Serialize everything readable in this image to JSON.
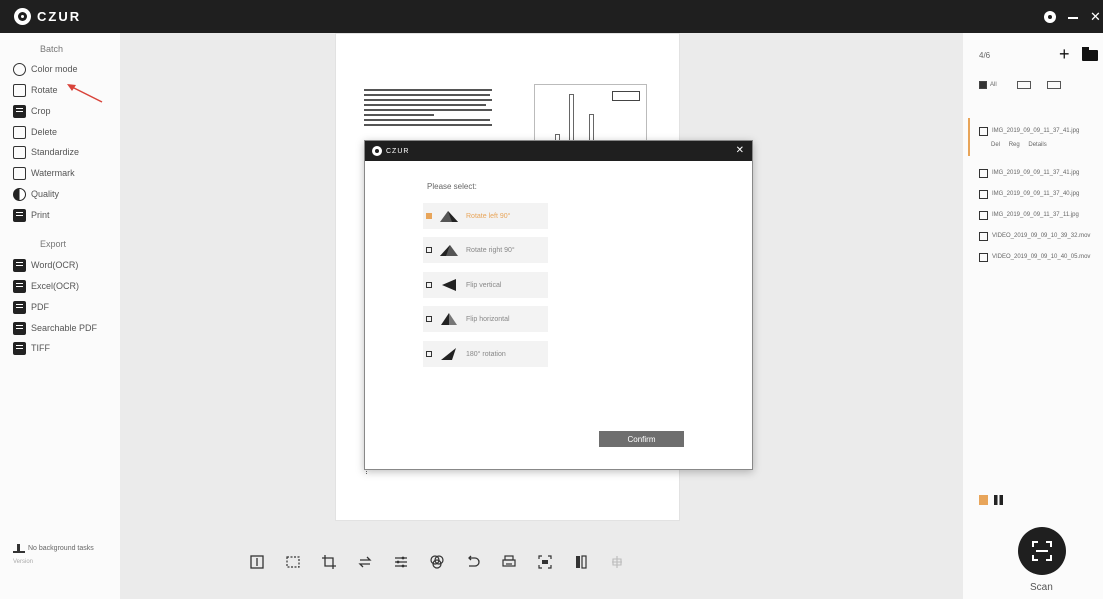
{
  "app": {
    "title": "CZUR"
  },
  "sidebar": {
    "batch_title": "Batch",
    "batch_items": [
      {
        "label": "Color mode",
        "icon": "color-mode-icon"
      },
      {
        "label": "Rotate",
        "icon": "rotate-icon"
      },
      {
        "label": "Crop",
        "icon": "crop-icon"
      },
      {
        "label": "Delete",
        "icon": "delete-icon"
      },
      {
        "label": "Standardize",
        "icon": "standardize-icon"
      },
      {
        "label": "Watermark",
        "icon": "watermark-icon"
      },
      {
        "label": "Quality",
        "icon": "quality-icon"
      },
      {
        "label": "Print",
        "icon": "print-icon"
      }
    ],
    "export_title": "Export",
    "export_items": [
      {
        "label": "Word(OCR)",
        "icon": "word-icon"
      },
      {
        "label": "Excel(OCR)",
        "icon": "excel-icon"
      },
      {
        "label": "PDF",
        "icon": "pdf-icon"
      },
      {
        "label": "Searchable PDF",
        "icon": "searchable-pdf-icon"
      },
      {
        "label": "TIFF",
        "icon": "tiff-icon"
      }
    ],
    "bottom_note": "No background tasks",
    "version": "Version"
  },
  "modal": {
    "title": "CZUR",
    "prompt": "Please select:",
    "options": [
      {
        "label": "Rotate left 90°",
        "selected": true,
        "icon": "rotate-left-icon"
      },
      {
        "label": "Rotate right 90°",
        "selected": false,
        "icon": "rotate-right-icon"
      },
      {
        "label": "Flip vertical",
        "selected": false,
        "icon": "flip-vertical-icon"
      },
      {
        "label": "Flip horizontal",
        "selected": false,
        "icon": "flip-horizontal-icon"
      },
      {
        "label": "180° rotation",
        "selected": false,
        "icon": "rotate-180-icon"
      }
    ],
    "confirm_label": "Confirm"
  },
  "right_panel": {
    "count": "4/6",
    "filter_all": "All",
    "files": [
      {
        "name": "IMG_2019_09_09_11_37_41.jpg",
        "checked": true
      },
      {
        "name": "IMG_2019_09_09_11_37_41.jpg",
        "checked": true
      },
      {
        "name": "IMG_2019_09_09_11_37_40.jpg",
        "checked": true
      },
      {
        "name": "IMG_2019_09_09_11_37_11.jpg",
        "checked": true
      },
      {
        "name": "VIDEO_2019_09_09_10_39_32.mov",
        "checked": false
      },
      {
        "name": "VIDEO_2019_09_09_10_40_05.mov",
        "checked": false
      }
    ],
    "file_actions": [
      "Del",
      "Reg",
      "Details"
    ],
    "scan_label": "Scan"
  },
  "colors": {
    "accent": "#e8a55a",
    "titlebar": "#1f1f1f"
  }
}
